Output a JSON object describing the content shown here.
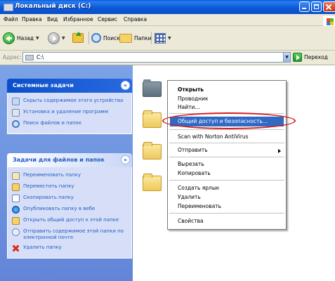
{
  "window": {
    "title": "Локальный диск (C:)"
  },
  "menu": [
    "Файл",
    "Правка",
    "Вид",
    "Избранное",
    "Сервис",
    "Справка"
  ],
  "toolbar": {
    "back_label": "Назад",
    "search_label": "Поиск",
    "folders_label": "Папки"
  },
  "address": {
    "label": "Адрес:",
    "value": "C:\\",
    "go_label": "Переход"
  },
  "system_tasks": {
    "title": "Системные задачи",
    "items": [
      "Скрыть содержимое этого устройства",
      "Установка и удаление программ",
      "Поиск файлов и папок"
    ]
  },
  "file_tasks": {
    "title": "Задачи для файлов и папок",
    "items": [
      "Переименовать папку",
      "Переместить папку",
      "Скопировать папку",
      "Опубликовать папку в вебе",
      "Открыть общий доступ к этой папке",
      "Отправить содержимое этой папки по электронной почте",
      "Удалить папку"
    ]
  },
  "context_menu": {
    "items": [
      "Открыть",
      "Проводник",
      "Найти...",
      "Общий доступ и безопасность...",
      "Scan with Norton AntiVirus",
      "Отправить",
      "Вырезать",
      "Копировать",
      "Создать ярлык",
      "Удалить",
      "Переименовать",
      "Свойства"
    ],
    "highlighted_index": 3,
    "bold_index": 0
  },
  "colors": {
    "highlight": "#316ac5",
    "annotation_ellipse": "#d81e1e",
    "taskpane_link": "#215dc6"
  }
}
